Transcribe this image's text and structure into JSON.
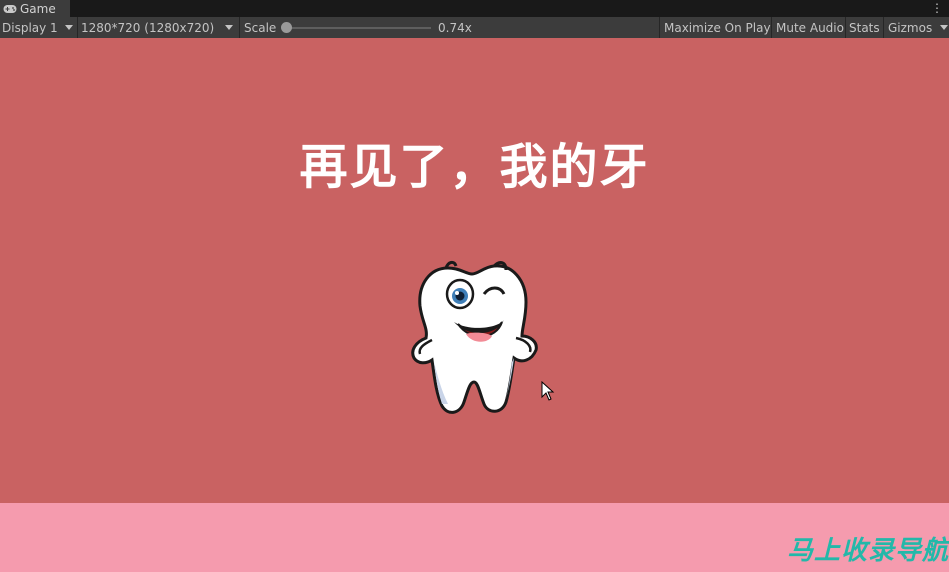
{
  "tab": {
    "label": "Game",
    "icon": "gamepad-icon"
  },
  "toolbar": {
    "display": "Display 1",
    "resolution": "1280*720 (1280x720)",
    "scale_label": "Scale",
    "scale_value": "0.74x",
    "maximize": "Maximize On Play",
    "mute": "Mute Audio",
    "stats": "Stats",
    "gizmos": "Gizmos"
  },
  "game": {
    "title": "再见了，我的牙",
    "character": "cartoon-tooth-illustration"
  },
  "watermark": "马上收录导航",
  "colors": {
    "background": "#c96262",
    "footer": "#f59bae",
    "watermark": "#23b8a9",
    "editor_bar": "#3c3c3c"
  }
}
